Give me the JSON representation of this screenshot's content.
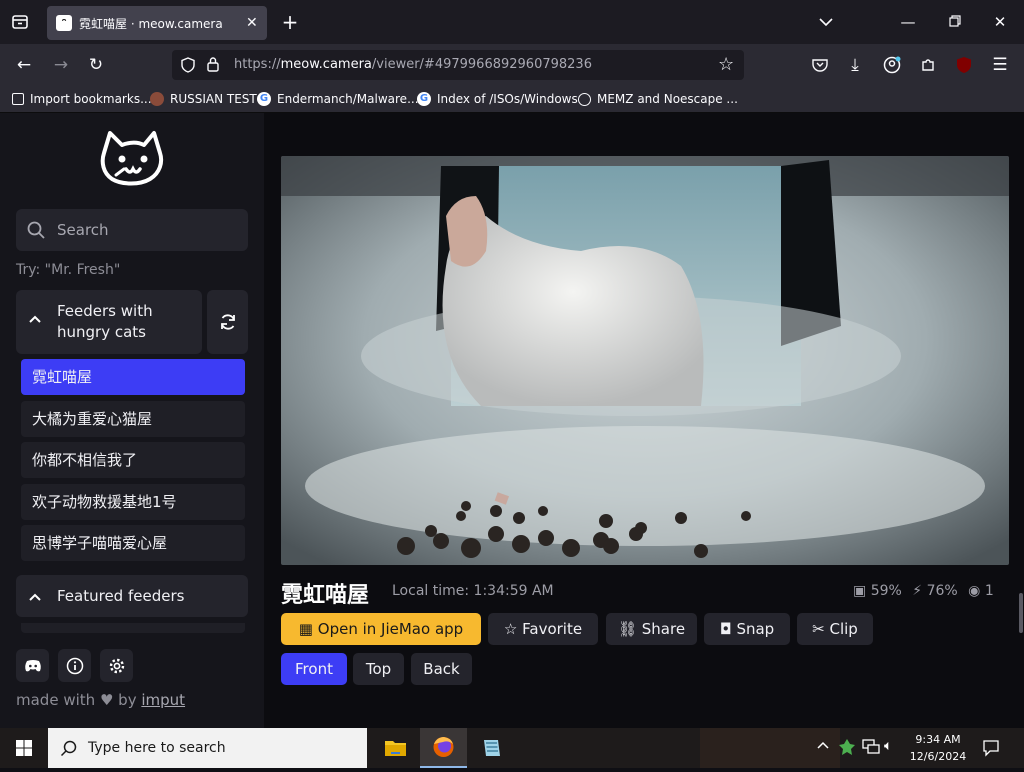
{
  "browser": {
    "tab_title": "霓虹喵屋 · meow.camera",
    "url_host_prefix": "https://",
    "url_host": "meow.camera",
    "url_path": "/viewer/#4979966892960798236",
    "bookmarks": [
      {
        "label": "Import bookmarks...",
        "icon": "import-icon"
      },
      {
        "label": "RUSSIAN TEST",
        "icon": "site-icon"
      },
      {
        "label": "Endermanch/Malware...",
        "icon": "google-icon"
      },
      {
        "label": "Index of /ISOs/Windows",
        "icon": "google-icon"
      },
      {
        "label": "MEMZ and Noescape ...",
        "icon": "globe-icon"
      }
    ]
  },
  "sidebar": {
    "search_placeholder": "Search",
    "try_hint": "Try: \"Mr. Fresh\"",
    "section_hungry": "Feeders with hungry cats",
    "feeders": [
      "霓虹喵屋",
      "大橘为重爱心猫屋",
      "你都不相信我了",
      "欢子动物救援基地1号",
      "思博学子喵喵爱心屋"
    ],
    "active_feeder_index": 0,
    "section_featured": "Featured feeders",
    "made_with_prefix": "made with",
    "made_with_by": "by",
    "made_with_author": "imput"
  },
  "viewer": {
    "title": "霓虹喵屋",
    "local_time": "Local time: 1:34:59 AM",
    "food_level": "59%",
    "battery_level": "76%",
    "viewers": "1",
    "actions": {
      "open_app": "Open in JieMao app",
      "favorite": "Favorite",
      "share": "Share",
      "snap": "Snap",
      "clip": "Clip"
    },
    "views": [
      "Front",
      "Top",
      "Back"
    ],
    "active_view_index": 0
  },
  "taskbar": {
    "search_placeholder": "Type here to search",
    "time": "9:34 AM",
    "date": "12/6/2024"
  },
  "colors": {
    "accent": "#3d3df5",
    "app_button": "#f7b92f",
    "page_bg": "#0c0c10"
  }
}
